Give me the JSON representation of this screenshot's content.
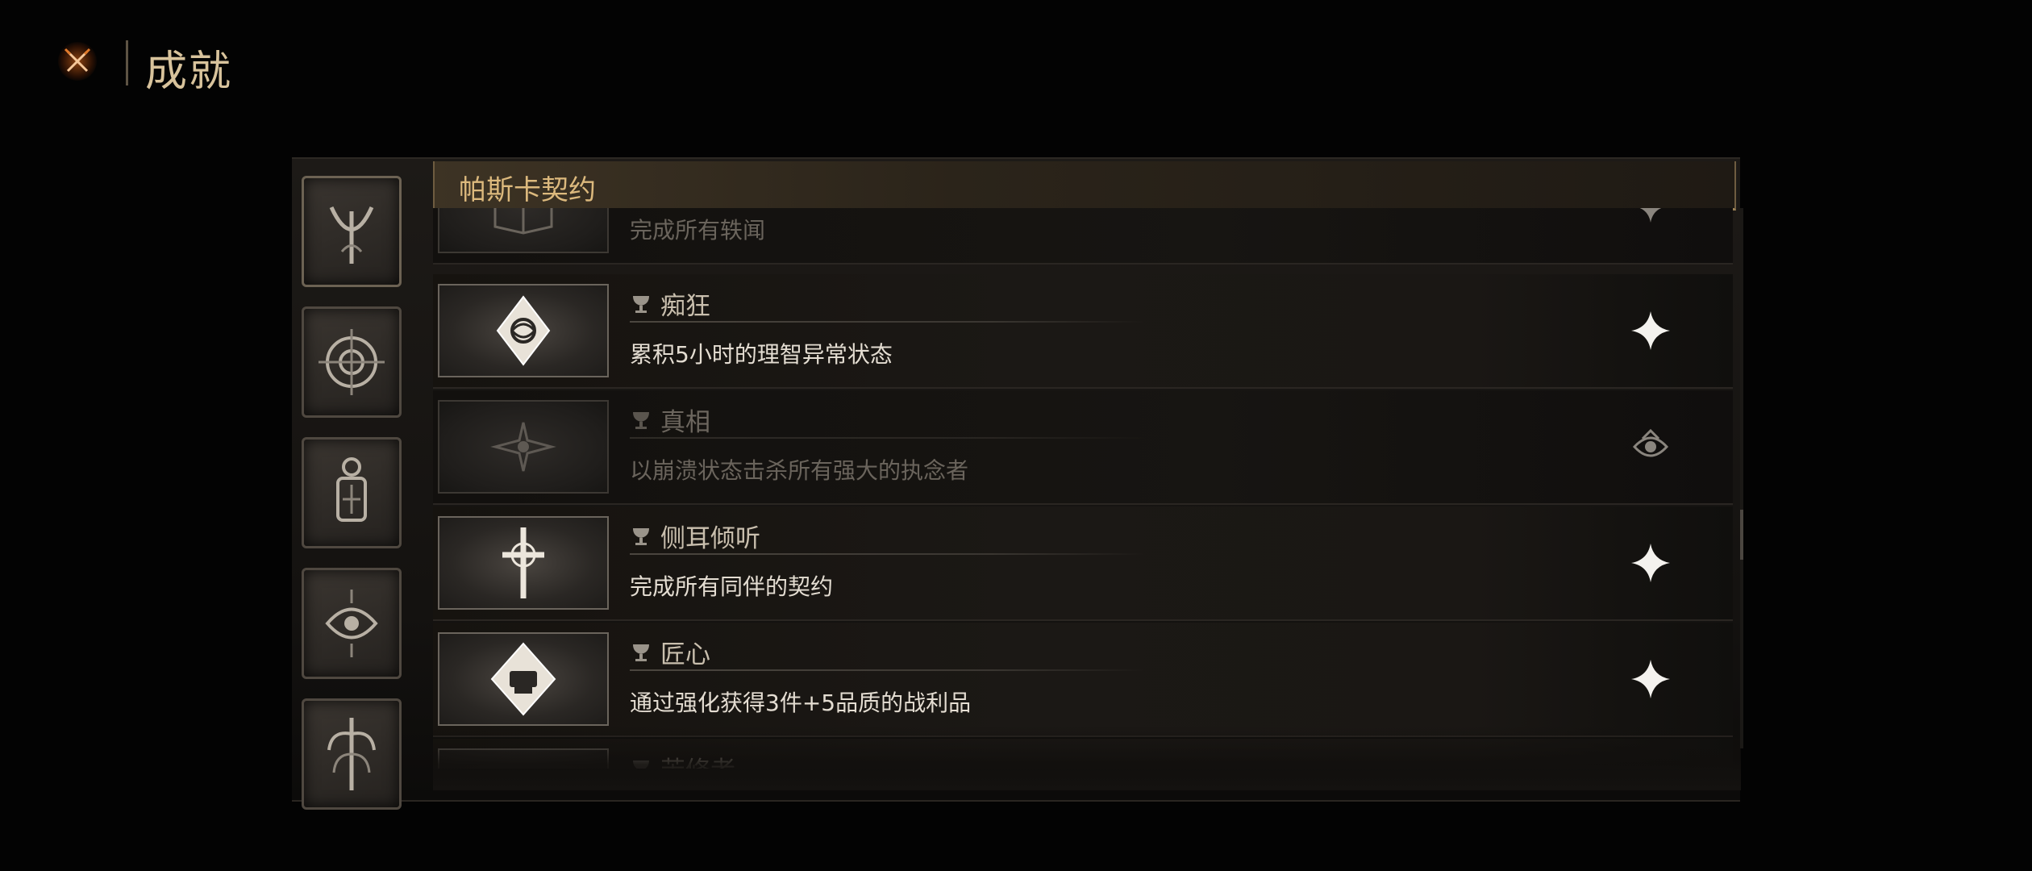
{
  "header": {
    "title": "成就"
  },
  "categories": [
    {
      "icon": "crescent-emblem-icon"
    },
    {
      "icon": "compass-wheel-icon"
    },
    {
      "icon": "lantern-icon"
    },
    {
      "icon": "eye-sigil-icon"
    },
    {
      "icon": "tree-sigil-icon"
    }
  ],
  "section": {
    "title": "帕斯卡契约"
  },
  "achievements": [
    {
      "name": "",
      "desc": "完成所有轶闻",
      "state": "locked",
      "status_icon": "sparkle-icon"
    },
    {
      "name": "痴狂",
      "desc": "累积5小时的理智异常状态",
      "state": "unlocked",
      "status_icon": "sparkle-icon"
    },
    {
      "name": "真相",
      "desc": "以崩溃状态击杀所有强大的执念者",
      "state": "locked",
      "status_icon": "eye-sigil-icon"
    },
    {
      "name": "侧耳倾听",
      "desc": "完成所有同伴的契约",
      "state": "unlocked",
      "status_icon": "sparkle-icon"
    },
    {
      "name": "匠心",
      "desc": "通过强化获得3件+5品质的战利品",
      "state": "unlocked",
      "status_icon": "sparkle-icon"
    },
    {
      "name": "苦修者",
      "desc": "",
      "state": "unlocked",
      "status_icon": "sparkle-icon"
    }
  ]
}
